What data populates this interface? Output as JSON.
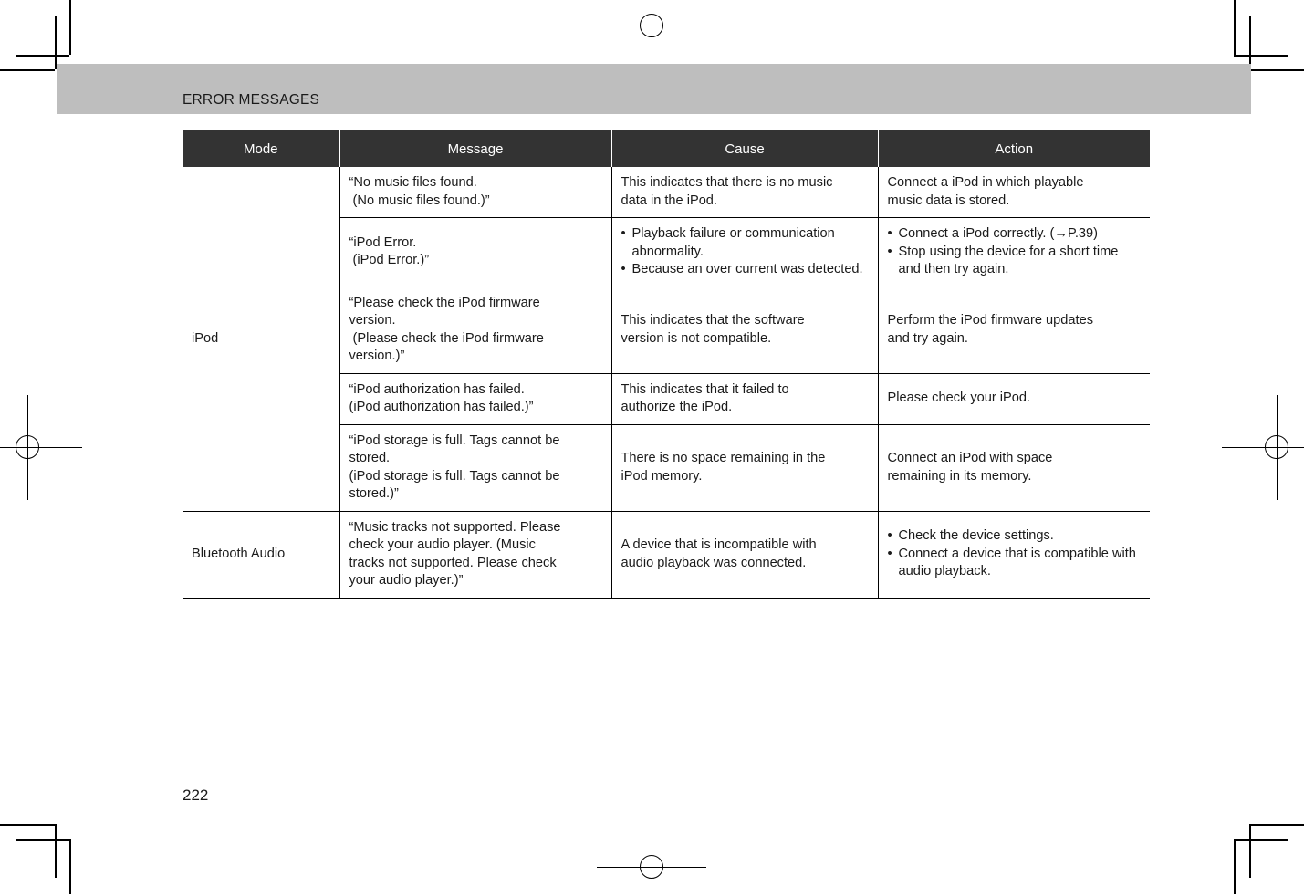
{
  "page": {
    "section_title": "ERROR MESSAGES",
    "page_number": "222"
  },
  "table": {
    "columns": [
      "Mode",
      "Message",
      "Cause",
      "Action"
    ],
    "rows": [
      {
        "mode": "iPod",
        "mode_rowspan": 5,
        "message_lines": [
          "“No music files found.",
          " (No music files found.)”"
        ],
        "cause_lines": [
          "This indicates that there is no music",
          "data in the iPod."
        ],
        "action_lines": [
          "Connect a iPod in which playable",
          "music data is stored."
        ],
        "cause_bullets": [],
        "action_bullets": []
      },
      {
        "message_lines": [
          "“iPod Error.",
          " (iPod Error.)”"
        ],
        "cause_lines": [],
        "action_lines": [],
        "cause_bullets": [
          "Playback failure or communication abnormality.",
          "Because an over current was detected."
        ],
        "action_bullets": [
          "Connect a iPod correctly. (→P.39)",
          "Stop using the device for a short time and then try again."
        ]
      },
      {
        "message_lines": [
          "“Please check the iPod firmware",
          "version.",
          " (Please check the iPod firmware",
          "version.)”"
        ],
        "cause_lines": [
          "This indicates that the software",
          "version is not compatible."
        ],
        "action_lines": [
          "Perform the iPod firmware updates",
          "and try again."
        ],
        "cause_bullets": [],
        "action_bullets": []
      },
      {
        "message_lines": [
          "“iPod authorization has failed.",
          "(iPod authorization has failed.)”"
        ],
        "cause_lines": [
          "This indicates that it failed to",
          "authorize the iPod."
        ],
        "action_lines": [
          "Please check your iPod."
        ],
        "cause_bullets": [],
        "action_bullets": []
      },
      {
        "message_lines": [
          "“iPod storage is full. Tags cannot be",
          "stored.",
          "(iPod storage is full. Tags cannot be",
          "stored.)”"
        ],
        "cause_lines": [
          "There is no space remaining in the",
          "iPod memory."
        ],
        "action_lines": [
          "Connect an iPod with space",
          "remaining in its memory."
        ],
        "cause_bullets": [],
        "action_bullets": []
      },
      {
        "mode": "Bluetooth Audio",
        "mode_rowspan": 1,
        "message_lines": [
          "“Music tracks not supported. Please",
          "check your audio player. (Music",
          "tracks not supported. Please check",
          "your audio player.)”"
        ],
        "cause_lines": [
          "A device that is incompatible with",
          "audio playback was connected."
        ],
        "action_lines": [],
        "cause_bullets": [],
        "action_bullets": [
          "Check the device settings.",
          "Connect a device that is compatible with audio playback."
        ]
      }
    ]
  },
  "colors": {
    "header_row_bg": "#333333",
    "band_bg": "#bebebe",
    "text": "#1a1a1a"
  }
}
